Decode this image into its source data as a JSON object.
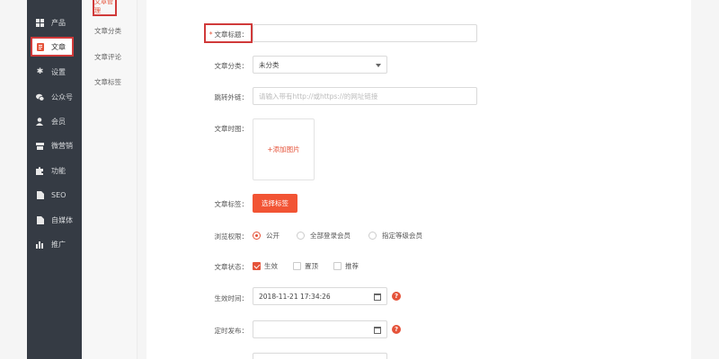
{
  "sidebar": {
    "items": [
      {
        "label": "产品",
        "icon": "grid-icon"
      },
      {
        "label": "文章",
        "icon": "document-icon",
        "active": true
      },
      {
        "label": "设置",
        "icon": "gear-icon"
      },
      {
        "label": "公众号",
        "icon": "wechat-icon"
      },
      {
        "label": "会员",
        "icon": "user-icon"
      },
      {
        "label": "微营销",
        "icon": "store-icon"
      },
      {
        "label": "功能",
        "icon": "puzzle-icon"
      },
      {
        "label": "SEO",
        "icon": "file-icon"
      },
      {
        "label": "自媒体",
        "icon": "file-icon"
      },
      {
        "label": "推广",
        "icon": "bar-chart-icon"
      }
    ]
  },
  "subnav": {
    "items": [
      {
        "label": "文章管理",
        "active": true
      },
      {
        "label": "文章分类"
      },
      {
        "label": "文章评论"
      },
      {
        "label": "文章标签"
      }
    ]
  },
  "form": {
    "title": {
      "label": "文章标题：",
      "required_mark": "*",
      "value": ""
    },
    "category": {
      "label": "文章分类：",
      "selected": "未分类"
    },
    "link": {
      "label": "跳转外链：",
      "placeholder": "请输入带有http://或https://的网址链接"
    },
    "image": {
      "label": "文章时图：",
      "add_text": "+添加图片"
    },
    "tags": {
      "label": "文章标签：",
      "button": "选择标签"
    },
    "permission": {
      "label": "浏览权限：",
      "options": [
        {
          "label": "公开",
          "checked": true
        },
        {
          "label": "全部登录会员",
          "checked": false
        },
        {
          "label": "指定等级会员",
          "checked": false
        }
      ]
    },
    "status": {
      "label": "文章状态：",
      "options": [
        {
          "label": "生效",
          "checked": true
        },
        {
          "label": "置顶",
          "checked": false
        },
        {
          "label": "推荐",
          "checked": false
        }
      ]
    },
    "effective_time": {
      "label": "生效时间：",
      "value": "2018-11-21 17:34:26"
    },
    "scheduled": {
      "label": "定时发布：",
      "value": ""
    }
  },
  "colors": {
    "accent": "#f25434",
    "sidebar_bg": "#353b44",
    "highlight_border": "#d03a3a"
  }
}
